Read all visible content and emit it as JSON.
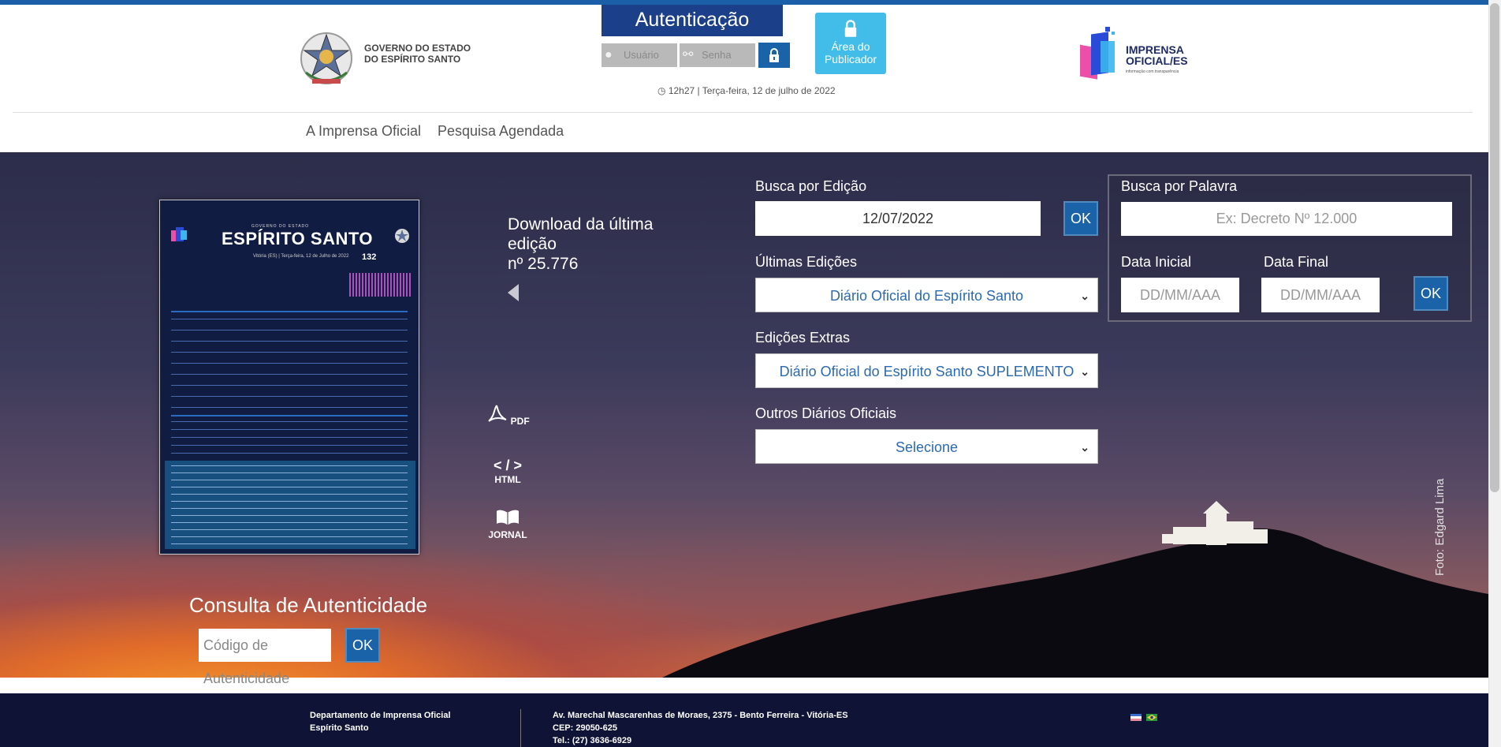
{
  "header": {
    "gov_name_line1": "GOVERNO DO ESTADO",
    "gov_name_line2": "DO ESPÍRITO SANTO",
    "auth_title": "Autenticação",
    "user_placeholder": "Usuário",
    "pass_placeholder": "Senha",
    "area_line1": "Área do",
    "area_line2": "Publicador",
    "clock_text": "12h27 | Terça-feira, 12 de julho de 2022",
    "io_logo_line1": "IMPRENSA",
    "io_logo_line2": "OFICIAL/ES",
    "io_logo_tagline": "informação com transparência"
  },
  "nav": {
    "items": [
      "A Imprensa Oficial",
      "Pesquisa Agendada"
    ]
  },
  "cover": {
    "title": "ESPÍRITO SANTO",
    "subtitle": "GOVERNO DO ESTADO",
    "date": "Vitória (ES) | Terça-feira, 12 de Julho de 2022",
    "number": "132"
  },
  "download": {
    "line1": "Download da última",
    "line2": "edição",
    "line3": "nº 25.776",
    "pdf_label": "PDF",
    "html_glyph": "< / >",
    "html_label": "HTML",
    "jornal_label": "JORNAL"
  },
  "authenticity": {
    "title": "Consulta de Autenticidade",
    "placeholder": "Código de Autenticidade",
    "ok_label": "OK"
  },
  "search_edition": {
    "label": "Busca por Edição",
    "date_value": "12/07/2022",
    "ok_label": "OK"
  },
  "last_editions": {
    "label": "Últimas Edições",
    "selected": "Diário Oficial do Espírito Santo"
  },
  "extra_editions": {
    "label": "Edições Extras",
    "selected": "Diário Oficial do Espírito Santo SUPLEMENTO"
  },
  "other_journals": {
    "label": "Outros Diários Oficiais",
    "selected": "Selecione"
  },
  "keyword_search": {
    "label": "Busca por Palavra",
    "placeholder": "Ex: Decreto Nº 12.000",
    "start_label": "Data Inicial",
    "end_label": "Data Final",
    "start_placeholder": "DD/MM/AAA",
    "end_placeholder": "DD/MM/AAA",
    "ok_label": "OK"
  },
  "photo_credit": "Foto: Edgard Lima",
  "footer": {
    "dept_line1": "Departamento de Imprensa Oficial",
    "dept_line2": "Espírito Santo",
    "addr_line1": "Av. Marechal Mascarenhas de Moraes, 2375 - Bento Ferreira - Vitória-ES",
    "addr_line2": "CEP: 29050-625",
    "addr_line3": "Tel.: (27) 3636-6929"
  },
  "colors": {
    "primary_blue": "#1a63a8",
    "auth_blue": "#1c3f8a",
    "area_cyan": "#42bdea",
    "footer_navy": "#0f1436"
  }
}
